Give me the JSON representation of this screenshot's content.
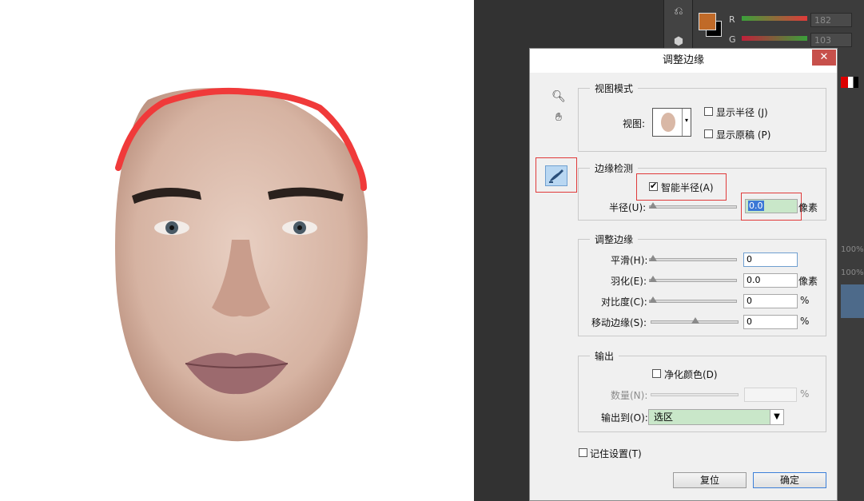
{
  "dialog": {
    "title": "调整边缘",
    "close_label": "✕",
    "view_mode": {
      "title": "视图模式",
      "view_label": "视图:",
      "show_radius": "显示半径 (J)",
      "show_original": "显示原稿 (P)"
    },
    "edge_detection": {
      "title": "边缘检测",
      "smart_radius": "智能半径(A)",
      "radius_label": "半径(U):",
      "radius_value": "0.0",
      "radius_unit": "像素"
    },
    "adjust_edge": {
      "title": "调整边缘",
      "smooth_label": "平滑(H):",
      "smooth_value": "0",
      "feather_label": "羽化(E):",
      "feather_value": "0.0",
      "feather_unit": "像素",
      "contrast_label": "对比度(C):",
      "contrast_value": "0",
      "contrast_unit": "%",
      "shift_label": "移动边缘(S):",
      "shift_value": "0",
      "shift_unit": "%"
    },
    "output": {
      "title": "输出",
      "decontaminate": "净化颜色(D)",
      "amount_label": "数量(N):",
      "amount_unit": "%",
      "output_to_label": "输出到(O):",
      "output_to_value": "选区"
    },
    "remember": "记住设置(T)",
    "reset_button": "复位",
    "ok_button": "确定"
  },
  "color_panel": {
    "r_label": "R",
    "r_value": "182",
    "g_label": "G",
    "g_value": "103",
    "foreground": "#c06a28",
    "background": "#000000",
    "pct1": "100%",
    "pct2": "100%"
  },
  "icons": {
    "zoom": "zoom-icon",
    "hand": "hand-icon",
    "refine_brush": "refine-radius-brush-icon"
  }
}
